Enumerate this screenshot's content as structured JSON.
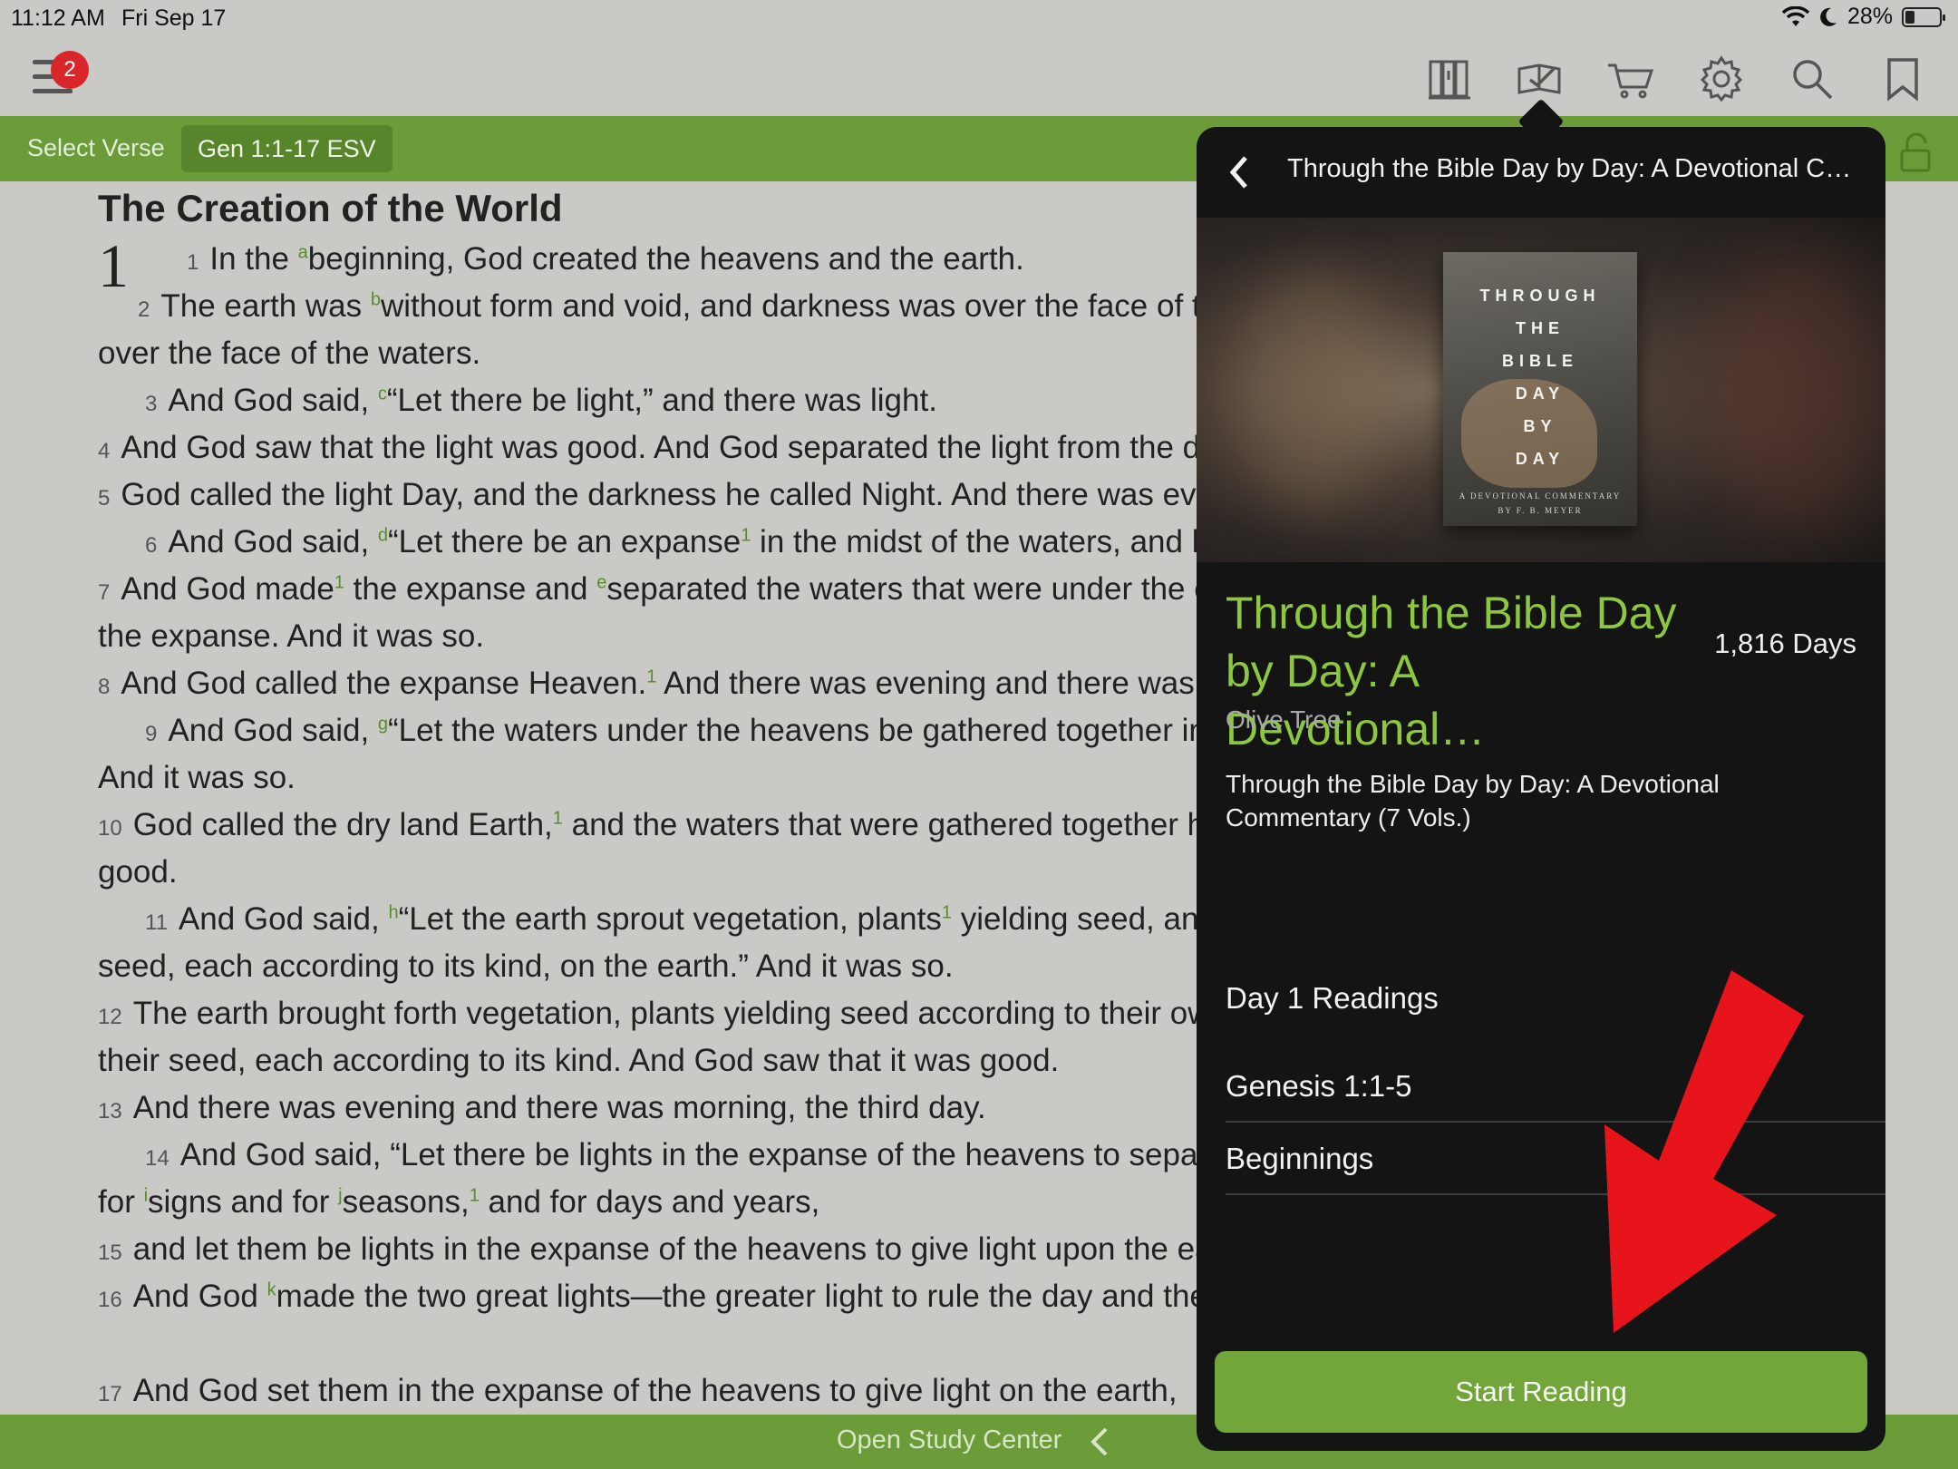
{
  "status_bar": {
    "time": "11:12 AM",
    "date": "Fri Sep 17",
    "battery": "28%",
    "battery_level": 0.28
  },
  "toolbar": {
    "menu_badge": "2",
    "icons": [
      "library-icon",
      "reading-plan-icon",
      "cart-icon",
      "gear-icon",
      "search-icon",
      "bookmark-icon"
    ]
  },
  "verse_bar": {
    "select_verse": "Select Verse",
    "reference": "Gen 1:1-17 ESV"
  },
  "bible": {
    "title": "The Creation of the World",
    "chapter": "1"
  },
  "bottom_bar": {
    "label": "Open Study Center"
  },
  "panel": {
    "header_title": "Through the Bible Day by Day: A Devotional C…",
    "cover": {
      "words": [
        "THROUGH",
        "THE",
        "BIBLE",
        "DAY",
        "BY",
        "DAY"
      ],
      "subtitle": "A DEVOTIONAL COMMENTARY",
      "author": "BY F. B. MEYER"
    },
    "plan_title": "Through the Bible Day by Day: A Devotional…",
    "days": "1,816 Days",
    "author": "Olive Tree",
    "description": "Through the Bible Day by Day: A Devotional Commentary (7 Vols.)",
    "day_heading": "Day 1 Readings",
    "readings": [
      "Genesis 1:1-5",
      "Beginnings"
    ],
    "start_button": "Start Reading"
  },
  "colors": {
    "green_bar": "#6c9c3a",
    "accent_green": "#8dc63f",
    "button_green": "#72a53a",
    "panel_bg": "#141414",
    "badge_red": "#d8262a",
    "annotation_red": "#e8141c"
  }
}
